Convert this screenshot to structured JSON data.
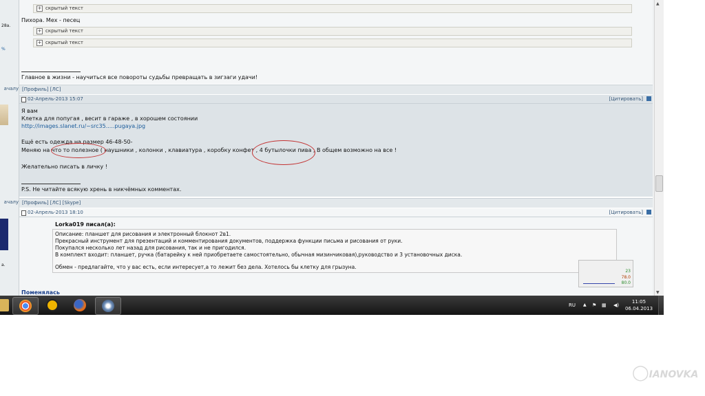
{
  "posts": [
    {
      "hidden_rows": [
        "скрытый текст",
        "скрытый текст",
        "скрытый текст"
      ],
      "line_author": "Пихора. Мех - песец",
      "signature": "Главное в жизни - научиться все повороты судьбы превращать в зигзаги удачи!"
    },
    {
      "date": "02-Апрель-2013 15:07",
      "quote_label": "[Цитировать]",
      "lines": [
        "Я вам",
        "Клетка для попугая , весит в гараже , в хорошем состоянии",
        "http://images.slanet.ru/~src35.....pugaya.jpg",
        "Ещё есть одежда на размер 46-48-50-",
        "Меняю на что то полезное ( наушники , колонки , клавиатура , коробку конфет , 4 бутылочки пива , В общем возможно на все !",
        "Желательно писать в личку !"
      ],
      "ps": "P.S. Не читайте всякую хрень в никчёмных комментах."
    },
    {
      "date": "02-Апрель-2013 18:10",
      "quote_label": "[Цитировать]",
      "quote_author": "Lorka019 писал(а):",
      "quote_lines": [
        "Описание: планшет для рисования и электронный блокнот 2в1.",
        "Прекрасный инструмент для презентаций и комментирования документов, поддержка функции письма и рисования от руки.",
        "Покупался несколько лет назад для рисования, так и не пригодился.",
        "В комплект входит: планшет, ручка (батарейку к ней приобретаете самостоятельно, обычная мизинчиковая),руководство и 3 установочных диска.",
        "Обмен - предлагайте, что у вас есть, если интересует,а то лежит без дела. Хотелось бы клетку для грызуна."
      ],
      "reply": "Поменялась"
    }
  ],
  "linkbars": [
    {
      "left": "ачалу",
      "links": "[Профиль]  [ЛС]"
    },
    {
      "left": "ачалу",
      "links": "[Профиль]  [ЛС]  [Skype]"
    }
  ],
  "left_fragments": [
    "28а.",
    "%",
    "а."
  ],
  "widget": {
    "v1": "23",
    "v2": "78.0",
    "v3": "80.0"
  },
  "taskbar": {
    "apps": [
      "explorer",
      "chrome",
      "daemon-tools",
      "firefox",
      "media-player"
    ],
    "lang": "RU",
    "time": "11:05",
    "date": "06.04.2013"
  },
  "watermark": "IANOVKA",
  "colors": {
    "link": "#1a5b9b",
    "highlight_oval": "#c23030",
    "taskbar": "#1e1e1e"
  }
}
